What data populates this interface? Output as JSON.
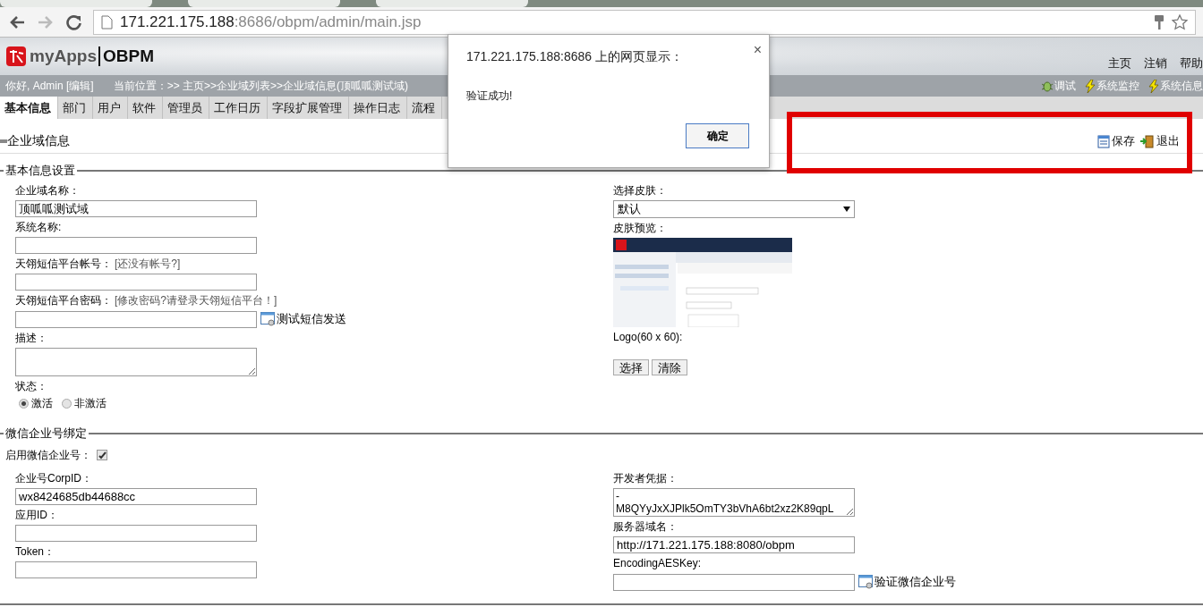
{
  "browser": {
    "nav": [
      {
        "kind": "back",
        "disabled": false
      },
      {
        "kind": "forward",
        "disabled": true
      },
      {
        "kind": "reload",
        "disabled": false
      }
    ],
    "url_host": "171.221.175.188",
    "url_rest": ":8686/obpm/admin/main.jsp"
  },
  "header": {
    "logo_left": "myApps",
    "logo_right": "OBPM",
    "links": [
      "主页",
      "注销",
      "帮助"
    ]
  },
  "info_bar": {
    "greeting": "你好, Admin [编辑]",
    "location": "当前位置：>> 主页>>企业域列表>>企业域信息(顶呱呱测试域)",
    "tools": [
      {
        "kind": "bug",
        "label": "调试"
      },
      {
        "kind": "bolt",
        "label": "系统监控"
      },
      {
        "kind": "bolt",
        "label": "系统信息"
      }
    ]
  },
  "tabs": [
    {
      "label": "基本信息",
      "selected": true
    },
    {
      "label": "部门",
      "selected": false
    },
    {
      "label": "用户",
      "selected": false
    },
    {
      "label": "软件",
      "selected": false
    },
    {
      "label": "管理员",
      "selected": false
    },
    {
      "label": "工作日历",
      "selected": false
    },
    {
      "label": "字段扩展管理",
      "selected": false
    },
    {
      "label": "操作日志",
      "selected": false
    },
    {
      "label": "流程",
      "selected": false
    }
  ],
  "toolbar": {
    "title": "企业域信息",
    "actions": [
      {
        "kind": "save",
        "label": "保存"
      },
      {
        "kind": "exit",
        "label": "退出"
      }
    ]
  },
  "sections": [
    {
      "legend": "基本信息设置",
      "left": [
        {
          "kind": "input",
          "label": "企业域名称：",
          "value": "顶呱呱测试域"
        },
        {
          "kind": "input",
          "label": "系统名称:"
        },
        {
          "kind": "input",
          "label": "天翎短信平台帐号：",
          "hint": "[还没有帐号?]"
        },
        {
          "kind": "input",
          "label": "天翎短信平台密码：",
          "hint": "[修改密码?请登录天翎短信平台！]",
          "action": "测试短信发送"
        },
        {
          "kind": "textarea",
          "label": "描述："
        },
        {
          "kind": "radio",
          "label": "状态：",
          "options": [
            {
              "label": "激活",
              "selected": true
            },
            {
              "label": "非激活",
              "selected": false
            }
          ]
        }
      ],
      "right": [
        {
          "kind": "select",
          "label": "选择皮肤：",
          "value": "默认"
        },
        {
          "kind": "preview",
          "label": "皮肤预览："
        },
        {
          "kind": "buttons",
          "label": "Logo(60 x 60):",
          "buttons": [
            "选择",
            "清除"
          ]
        }
      ]
    },
    {
      "legend": "微信企业号绑定",
      "checkbox": {
        "label": "启用微信企业号：",
        "checked": true
      },
      "left": [
        {
          "kind": "input",
          "label": "企业号CorpID：",
          "value": "wx8424685db44688cc"
        },
        {
          "kind": "input",
          "label": "应用ID："
        },
        {
          "kind": "input",
          "label": "Token："
        }
      ],
      "right": [
        {
          "kind": "textarea",
          "label": "开发者凭据：",
          "value": "-\nM8QYyJxXJPlk5OmTY3bVhA6bt2xz2K89qpL"
        },
        {
          "kind": "input",
          "label": "服务器域名：",
          "value": "http://171.221.175.188:8080/obpm"
        },
        {
          "kind": "input",
          "label": "EncodingAESKey:",
          "action": "验证微信企业号"
        }
      ]
    }
  ],
  "dialog": {
    "title": "171.221.175.188:8686 上的网页显示：",
    "close": "×",
    "message": "验证成功!",
    "button": "确定"
  }
}
